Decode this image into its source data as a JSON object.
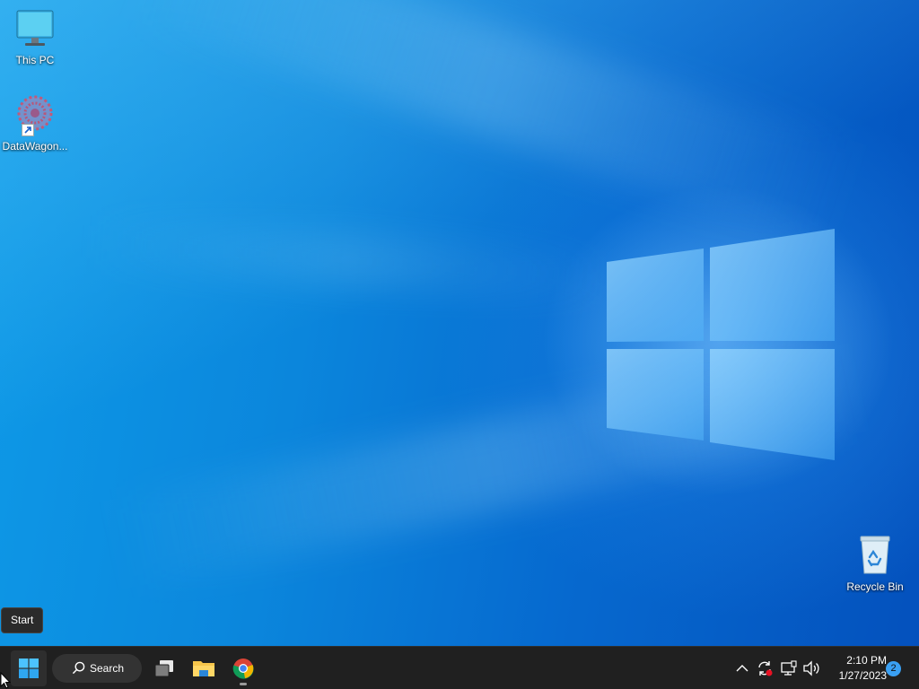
{
  "desktop": {
    "icons": [
      {
        "label": "This PC",
        "icon": "monitor-icon"
      },
      {
        "label": "DataWagon...",
        "icon": "gear-cluster-icon"
      },
      {
        "label": "Recycle Bin",
        "icon": "recycle-bin-icon"
      }
    ]
  },
  "tooltip": {
    "text": "Start"
  },
  "taskbar": {
    "start_icon": "windows-logo-icon",
    "search_label": "Search",
    "search_icon": "search-icon",
    "apps": [
      {
        "name": "Task View",
        "icon": "task-view-icon"
      },
      {
        "name": "File Explorer",
        "icon": "folder-icon"
      },
      {
        "name": "Google Chrome",
        "icon": "chrome-icon",
        "running": true
      }
    ],
    "tray": {
      "icons": [
        "chevron-up-icon",
        "sync-icon",
        "network-icon",
        "volume-icon"
      ],
      "time": "2:10 PM",
      "date": "1/27/2023",
      "notification_count": "2"
    }
  },
  "colors": {
    "wallpaper_blue": "#0a78d7",
    "taskbar_bg": "#202020",
    "accent": "#3aa0f3"
  }
}
